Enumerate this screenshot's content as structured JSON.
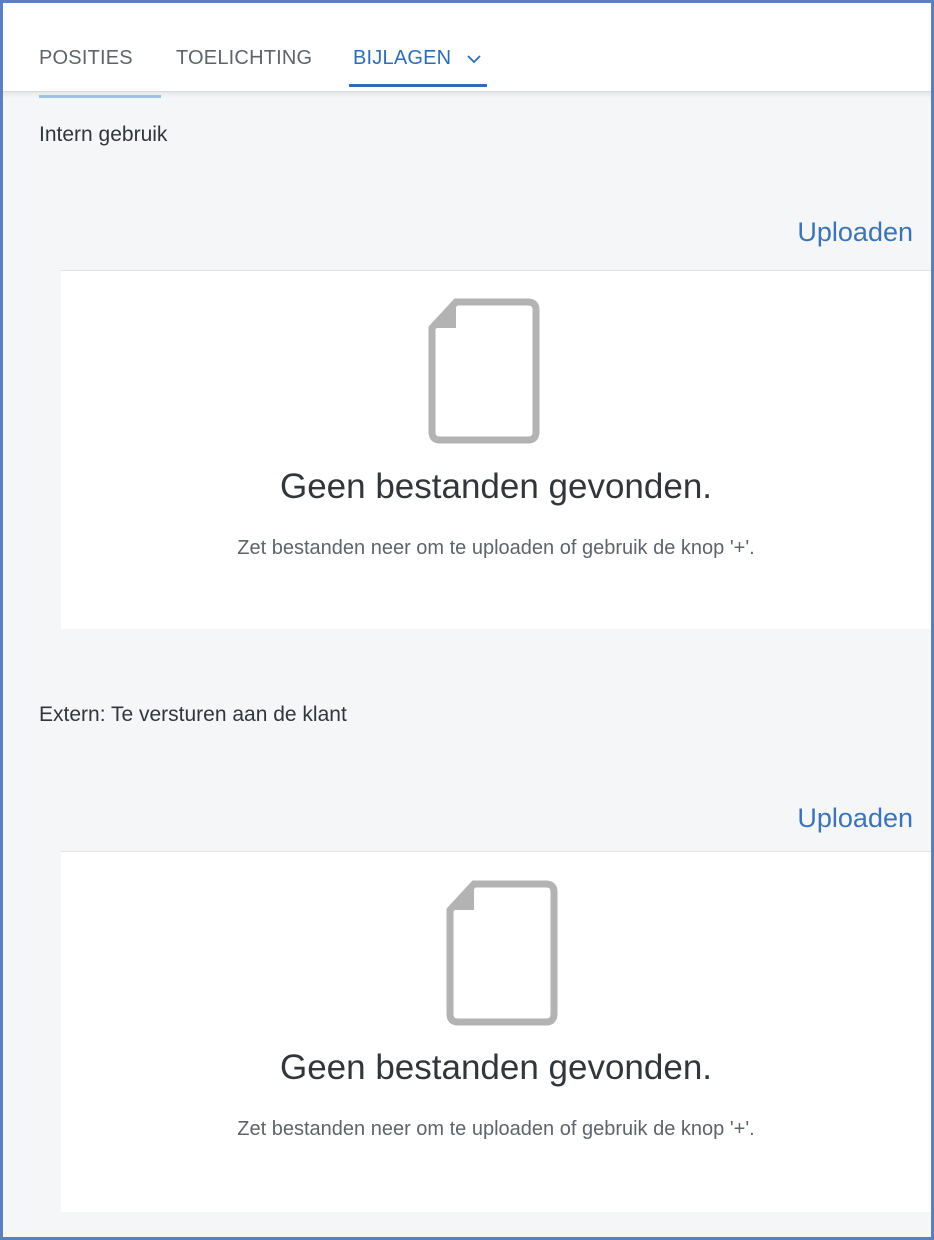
{
  "tabs": {
    "positions_label": "POSITIES",
    "notes_label": "TOELICHTING",
    "attachments_label": "BIJLAGEN"
  },
  "sections": [
    {
      "title": "Intern gebruik",
      "upload_label": "Uploaden",
      "empty_title": "Geen bestanden gevonden.",
      "empty_hint": "Zet bestanden neer om te uploaden of gebruik de knop '+'."
    },
    {
      "title": "Extern: Te versturen aan de klant",
      "upload_label": "Uploaden",
      "empty_title": "Geen bestanden gevonden.",
      "empty_hint": "Zet bestanden neer om te uploaden of gebruik de knop '+'."
    }
  ],
  "colors": {
    "accent": "#2d6db5",
    "link": "#3d74b6",
    "background": "#f5f6f7",
    "panel": "#ffffff",
    "icon": "#b3b3b3"
  },
  "icons": {
    "tab_dropdown": "chevron-down-icon",
    "empty_state": "document-icon"
  }
}
